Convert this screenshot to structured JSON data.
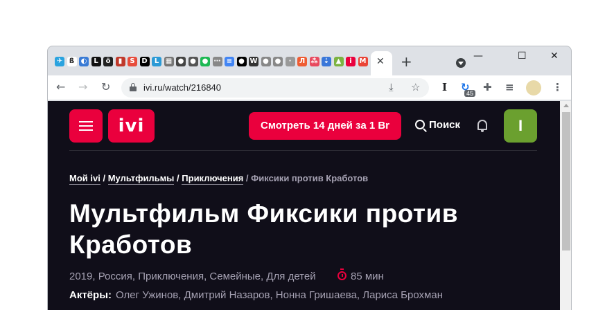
{
  "browser": {
    "url": "ivi.ru/watch/216840",
    "tab_close_glyph": "✕",
    "new_tab_glyph": "+",
    "window_controls": {
      "minimize": "—",
      "maximize": "☐",
      "close": "✕"
    },
    "nav": {
      "back": "←",
      "forward": "→",
      "reload": "↻"
    },
    "extension_badge": "45",
    "extension_letter": "I",
    "tab_favicons": [
      {
        "icon": "telegram-icon",
        "glyph": "✈",
        "color": "#2aa3df"
      },
      {
        "icon": "eszett-icon",
        "glyph": "ß",
        "color": "#ffffff"
      },
      {
        "icon": "swirl-icon",
        "glyph": "◐",
        "color": "#3a7bd5"
      },
      {
        "icon": "letter-l-icon",
        "glyph": "L",
        "color": "#111111"
      },
      {
        "icon": "letter-o-icon",
        "glyph": "ö",
        "color": "#222222"
      },
      {
        "icon": "bar-icon",
        "glyph": "▮",
        "color": "#c0392b"
      },
      {
        "icon": "letter-s-icon",
        "glyph": "S",
        "color": "#e74c3c"
      },
      {
        "icon": "dev-icon",
        "glyph": "D",
        "color": "#000000"
      },
      {
        "icon": "lr-icon",
        "glyph": "L",
        "color": "#2b9ad6"
      },
      {
        "icon": "grid-icon",
        "glyph": "▦",
        "color": "#777777"
      },
      {
        "icon": "globe-icon",
        "glyph": "●",
        "color": "#444444"
      },
      {
        "icon": "globe2-icon",
        "glyph": "●",
        "color": "#555555"
      },
      {
        "icon": "spotify-icon",
        "glyph": "●",
        "color": "#1db954"
      },
      {
        "icon": "dots-icon",
        "glyph": "⋯",
        "color": "#888888"
      },
      {
        "icon": "docs-icon",
        "glyph": "≡",
        "color": "#4285f4"
      },
      {
        "icon": "medium-icon",
        "glyph": "●",
        "color": "#000000"
      },
      {
        "icon": "wikipedia-icon",
        "glyph": "W",
        "color": "#333333"
      },
      {
        "icon": "apple-icon",
        "glyph": "●",
        "color": "#888888"
      },
      {
        "icon": "apple2-icon",
        "glyph": "●",
        "color": "#888888"
      },
      {
        "icon": "dots2-icon",
        "glyph": "∙",
        "color": "#999999"
      },
      {
        "icon": "letter-l2-icon",
        "glyph": "Л",
        "color": "#ef5c33"
      },
      {
        "icon": "cluster-icon",
        "glyph": "⁂",
        "color": "#e84a5f"
      },
      {
        "icon": "download-icon",
        "glyph": "⇣",
        "color": "#3a77d9"
      },
      {
        "icon": "android-icon",
        "glyph": "▲",
        "color": "#7cb342"
      },
      {
        "icon": "ivi-icon",
        "glyph": "i",
        "color": "#ea003d"
      },
      {
        "icon": "gmail-icon",
        "glyph": "M",
        "color": "#ea4335"
      }
    ]
  },
  "site": {
    "logo_text": "ivi",
    "cta_label": "Смотреть 14 дней за 1 Br",
    "search_label": "Поиск",
    "profile_initial": "I",
    "colors": {
      "accent": "#ea003d",
      "profile": "#6ba02f",
      "background": "#100e19"
    }
  },
  "breadcrumb": {
    "items": [
      "Мой ivi",
      "Мультфильмы",
      "Приключения"
    ],
    "separator": "/",
    "current": "Фиксики против Кработов"
  },
  "movie": {
    "title": "Мультфильм Фиксики против Кработов",
    "meta": "2019, Россия, Приключения, Семейные, Для детей",
    "duration": "85 мин",
    "actors_label": "Актёры:",
    "actors": "Олег Ужинов, Дмитрий Назаров, Нонна Гришаева, Лариса Брохман"
  }
}
